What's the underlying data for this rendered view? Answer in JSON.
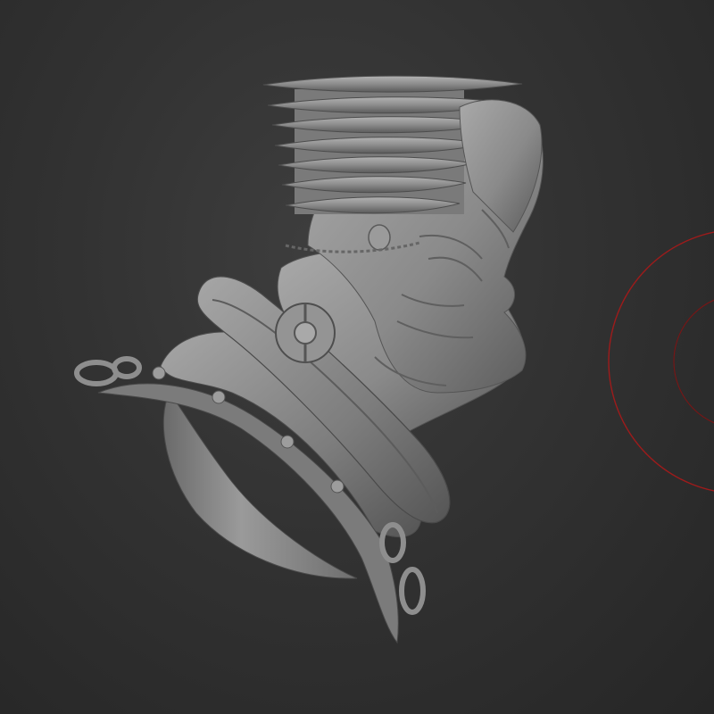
{
  "viewport": {
    "background_color": "#333333",
    "model_color": "#8f8f8f",
    "brush_cursor_color": "#9e1b1b"
  },
  "model": {
    "icon": "sculpted-bust"
  },
  "brush_cursor": {
    "icon": "brush-radius-ring"
  }
}
